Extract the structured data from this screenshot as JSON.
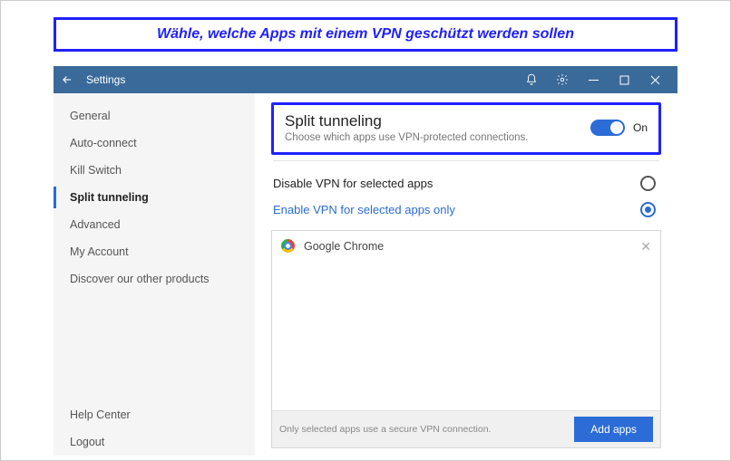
{
  "annotation": "Wähle, welche Apps mit einem VPN geschützt werden sollen",
  "titlebar": {
    "title": "Settings"
  },
  "sidebar": {
    "items": [
      {
        "label": "General"
      },
      {
        "label": "Auto-connect"
      },
      {
        "label": "Kill Switch"
      },
      {
        "label": "Split tunneling"
      },
      {
        "label": "Advanced"
      },
      {
        "label": "My Account"
      },
      {
        "label": "Discover our other products"
      }
    ],
    "footer": [
      {
        "label": "Help Center"
      },
      {
        "label": "Logout"
      }
    ]
  },
  "main": {
    "heading": "Split tunneling",
    "subheading": "Choose which apps use VPN-protected connections.",
    "toggle_state": "On",
    "options": [
      {
        "label": "Disable VPN for selected apps",
        "selected": false
      },
      {
        "label": "Enable VPN for selected apps only",
        "selected": true
      }
    ],
    "apps": [
      {
        "name": "Google Chrome"
      }
    ],
    "footer_hint": "Only selected apps use a secure VPN connection.",
    "add_button": "Add apps"
  }
}
